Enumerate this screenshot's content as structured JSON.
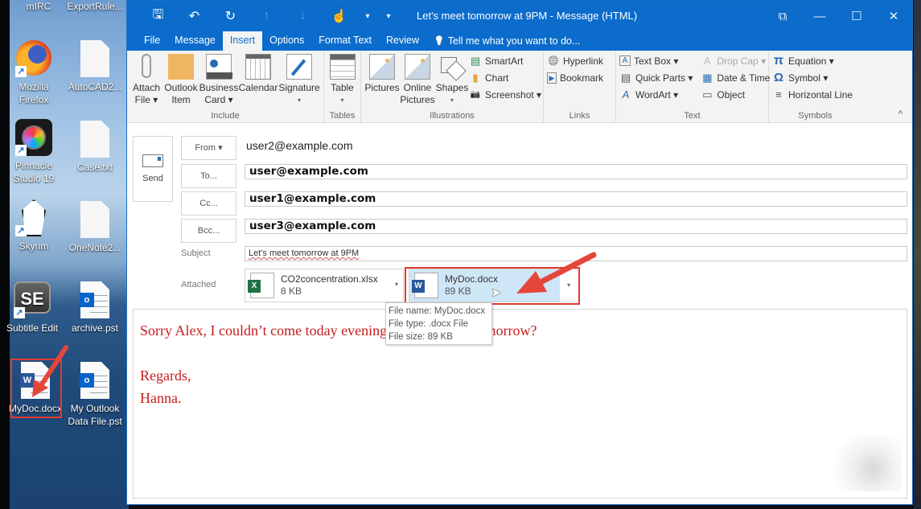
{
  "desktop": {
    "icons": [
      {
        "label": "mIRC",
        "icon": "mirc-icon"
      },
      {
        "label": "ExportRule...",
        "icon": "file-icon"
      },
      {
        "label": "Mozilla Firefox",
        "icon": "firefox-icon"
      },
      {
        "label": "AutoCAD2...",
        "icon": "file-icon"
      },
      {
        "label": "Pinnacle Studio 19",
        "icon": "pinnacle-icon"
      },
      {
        "label": "Case.txt",
        "icon": "file-icon"
      },
      {
        "label": "Skyrim",
        "icon": "skyrim-icon"
      },
      {
        "label": "OneNote2...",
        "icon": "file-icon"
      },
      {
        "label": "Subtitle Edit",
        "icon": "subtitle-edit-icon"
      },
      {
        "label": "archive.pst",
        "icon": "outlook-data-icon"
      },
      {
        "label": "MyDoc.docx",
        "icon": "word-doc-icon"
      },
      {
        "label": "My Outlook Data File.pst",
        "icon": "outlook-data-icon"
      }
    ],
    "shortcut_glyph": "↗"
  },
  "window": {
    "title": "Let's meet tomorrow at 9PM - Message (HTML)",
    "qat": {
      "save": "🖫",
      "undo": "↶",
      "redo": "↻",
      "up": "↑",
      "down": "↓",
      "touch": "☝",
      "dropdown": "▾",
      "customize": "▾"
    },
    "controls": {
      "ribbon_display": "⧉",
      "minimize": "—",
      "maximize": "☐",
      "close": "✕"
    }
  },
  "tabs": [
    {
      "label": "File"
    },
    {
      "label": "Message"
    },
    {
      "label": "Insert",
      "active": true
    },
    {
      "label": "Options"
    },
    {
      "label": "Format Text"
    },
    {
      "label": "Review"
    }
  ],
  "tell_me": {
    "icon": "lightbulb-icon",
    "glyph": "💡",
    "label": "Tell me what you want to do..."
  },
  "ribbon": {
    "include": {
      "label": "Include",
      "buttons": [
        {
          "line1": "Attach",
          "line2": "File ▾"
        },
        {
          "line1": "Outlook",
          "line2": "Item"
        },
        {
          "line1": "Business",
          "line2": "Card ▾"
        },
        {
          "line1": "Calendar",
          "line2": ""
        },
        {
          "line1": "Signature",
          "line2": "▾"
        }
      ]
    },
    "tables": {
      "label": "Tables",
      "button": {
        "line1": "Table",
        "line2": "▾"
      }
    },
    "illustrations": {
      "label": "Illustrations",
      "buttons": [
        {
          "line1": "Pictures",
          "line2": ""
        },
        {
          "line1": "Online",
          "line2": "Pictures"
        },
        {
          "line1": "Shapes",
          "line2": "▾"
        }
      ],
      "small": [
        {
          "label": "SmartArt",
          "glyph": "▤"
        },
        {
          "label": "Chart",
          "glyph": "▮"
        },
        {
          "label": "Screenshot ▾",
          "glyph": "📷"
        }
      ]
    },
    "links": {
      "label": "Links",
      "small": [
        {
          "label": "Hyperlink",
          "glyph": "🌐"
        },
        {
          "label": "Bookmark",
          "glyph": "▶"
        }
      ]
    },
    "text": {
      "label": "Text",
      "col1": [
        {
          "label": "Text Box ▾",
          "glyph": "A",
          "disabled": false
        },
        {
          "label": "Quick Parts ▾",
          "glyph": "▤",
          "disabled": false
        },
        {
          "label": "WordArt ▾",
          "glyph": "A",
          "disabled": false
        }
      ],
      "col2": [
        {
          "label": "Drop Cap ▾",
          "glyph": "A",
          "disabled": true
        },
        {
          "label": "Date & Time",
          "glyph": "▦",
          "disabled": false
        },
        {
          "label": "Object",
          "glyph": "▭",
          "disabled": false
        }
      ]
    },
    "symbols": {
      "label": "Symbols",
      "small": [
        {
          "label": "Equation ▾",
          "glyph": "π"
        },
        {
          "label": "Symbol ▾",
          "glyph": "Ω"
        },
        {
          "label": "Horizontal Line",
          "glyph": "≡"
        }
      ]
    },
    "collapse_glyph": "^"
  },
  "compose": {
    "send_label": "Send",
    "from_label": "From ▾",
    "from_value": "user2@example.com",
    "to_label": "To...",
    "to_value": "user@example.com",
    "cc_label": "Cc...",
    "cc_value": "user1@example.com",
    "bcc_label": "Bcc...",
    "bcc_value": "user3@example.com",
    "subject_label": "Subject",
    "subject_value": "Let's meet tomorrow at 9PM",
    "attached_label": "Attached",
    "attachments": [
      {
        "name": "CO2concentration.xlsx",
        "size": "8 KB",
        "type": "excel",
        "badge": "X",
        "color": "#1f7244"
      },
      {
        "name": "MyDoc.docx",
        "size": "89 KB",
        "type": "word",
        "badge": "W",
        "color": "#2b579a",
        "selected": true
      }
    ],
    "attachment_dropdown_glyph": "▾",
    "tooltip": {
      "file_name": "File name:  MyDoc.docx",
      "file_type": "File type:  .docx File",
      "file_size": "File size:  89 KB"
    },
    "body": {
      "line1": "Sorry Alex, I couldn’t come today evening. Can we meet tomorrow?",
      "line2": "Regards,",
      "line3": "Hanna.",
      "color": "#c41e1e"
    }
  },
  "annotations": {
    "highlight_color": "#e03a2f"
  }
}
